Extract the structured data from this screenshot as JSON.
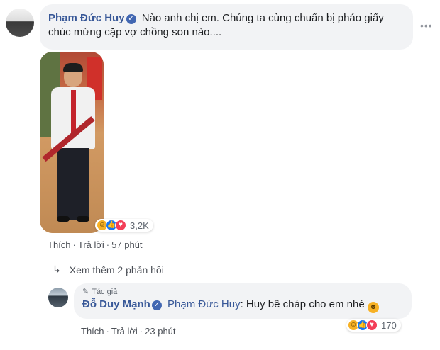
{
  "comment": {
    "author": "Phạm Đức Huy",
    "text": "Nào anh chị em. Chúng ta cùng chuẩn bị pháo giấy chúc mừng cặp vợ chồng son nào....",
    "reaction_count": "3,2K",
    "like_label": "Thích",
    "reply_label": "Trả lời",
    "time": "57 phút",
    "more_icon": "ellipsis-icon",
    "reaction_icons": [
      "haha-icon",
      "like-icon",
      "love-icon"
    ]
  },
  "more_replies": {
    "label": "Xem thêm 2 phản hồi",
    "icon": "reply-arrow-icon"
  },
  "reply": {
    "tag": "Tác giả",
    "tag_icon": "pencil-icon",
    "author": "Đỗ Duy Mạnh",
    "mention": "Phạm Đức Huy",
    "text": ": Huy bê cháp cho em nhé",
    "emoji": "grinning-face-icon",
    "reaction_count": "170",
    "like_label": "Thích",
    "reply_label": "Trả lời",
    "time": "23 phút"
  },
  "colors": {
    "link": "#385898",
    "bubble": "#f2f3f5",
    "meta": "#606770",
    "verified": "#4267b2"
  }
}
